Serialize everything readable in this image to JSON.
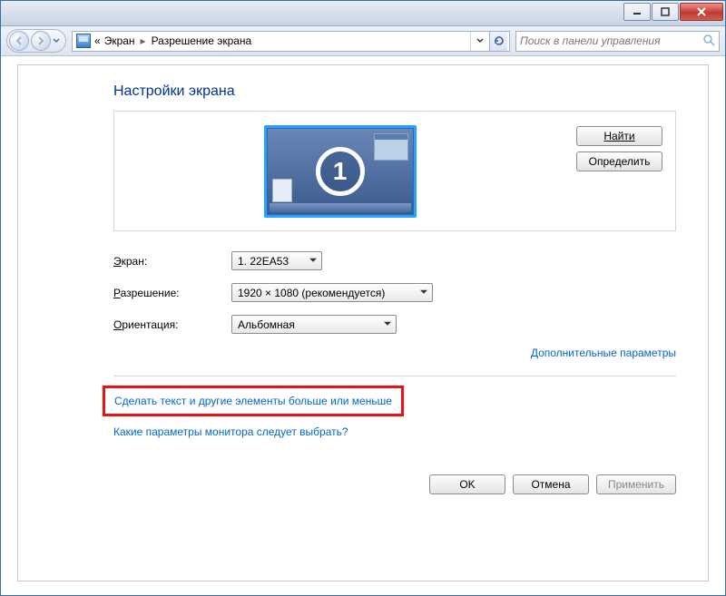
{
  "titlebar": {},
  "nav": {
    "guillemet": "«",
    "crumb1": "Экран",
    "crumb2": "Разрешение экрана"
  },
  "search": {
    "placeholder": "Поиск в панели управления"
  },
  "page": {
    "title": "Настройки экрана",
    "monitor_number": "1",
    "btn_detect": "Найти",
    "btn_identify": "Определить"
  },
  "form": {
    "screen_label_pre": "Э",
    "screen_label_post": "кран:",
    "screen_value": "1. 22EA53",
    "res_label_pre": "Р",
    "res_label_post": "азрешение:",
    "res_value": "1920 × 1080 (рекомендуется)",
    "orient_label_pre": "О",
    "orient_label_post": "риентация:",
    "orient_value": "Альбомная"
  },
  "links": {
    "advanced": "Дополнительные параметры",
    "text_size": "Сделать текст и другие элементы больше или меньше",
    "which_settings": "Какие параметры монитора следует выбрать?"
  },
  "footer": {
    "ok": "OK",
    "cancel": "Отмена",
    "apply": "Применить"
  }
}
